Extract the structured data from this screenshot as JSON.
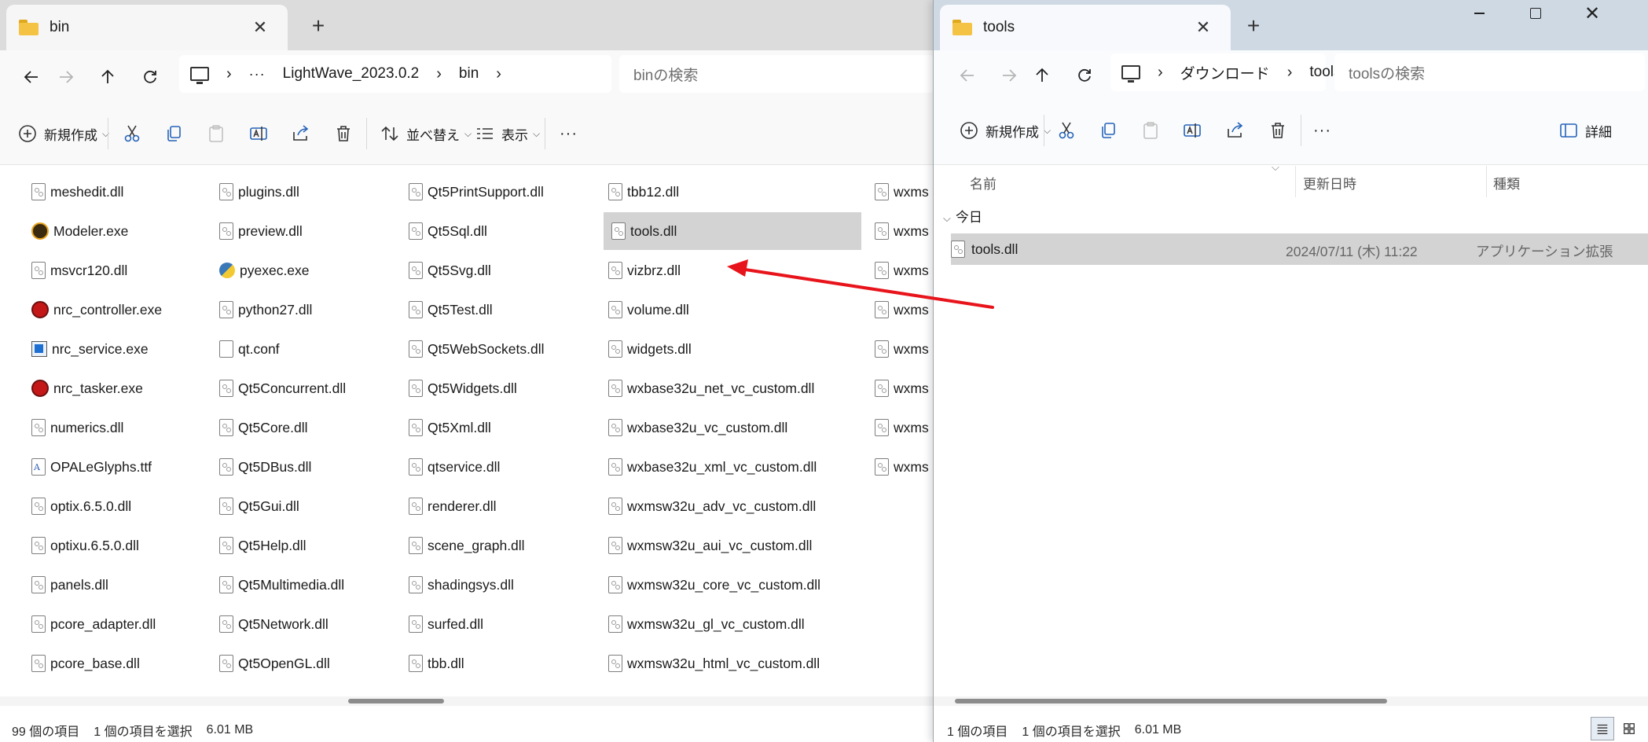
{
  "left_window": {
    "tab_title": "bin",
    "address": {
      "ellipsis": "···",
      "segments": [
        "LightWave_2023.0.2",
        "bin"
      ]
    },
    "search_placeholder": "binの検索",
    "commands": {
      "new": "新規作成",
      "sort": "並べ替え",
      "view": "表示",
      "more": "···"
    },
    "columns": [
      [
        {
          "name": "meshedit.dll",
          "icon": "dll"
        },
        {
          "name": "Modeler.exe",
          "icon": "lw"
        },
        {
          "name": "msvcr120.dll",
          "icon": "dll"
        },
        {
          "name": "nrc_controller.exe",
          "icon": "nrc"
        },
        {
          "name": "nrc_service.exe",
          "icon": "svc"
        },
        {
          "name": "nrc_tasker.exe",
          "icon": "nrc"
        },
        {
          "name": "numerics.dll",
          "icon": "dll"
        },
        {
          "name": "OPALeGlyphs.ttf",
          "icon": "ttf"
        },
        {
          "name": "optix.6.5.0.dll",
          "icon": "dll"
        },
        {
          "name": "optixu.6.5.0.dll",
          "icon": "dll"
        },
        {
          "name": "panels.dll",
          "icon": "dll"
        },
        {
          "name": "pcore_adapter.dll",
          "icon": "dll"
        },
        {
          "name": "pcore_base.dll",
          "icon": "dll"
        }
      ],
      [
        {
          "name": "plugins.dll",
          "icon": "dll"
        },
        {
          "name": "preview.dll",
          "icon": "dll"
        },
        {
          "name": "pyexec.exe",
          "icon": "py"
        },
        {
          "name": "python27.dll",
          "icon": "dll"
        },
        {
          "name": "qt.conf",
          "icon": "conf"
        },
        {
          "name": "Qt5Concurrent.dll",
          "icon": "dll"
        },
        {
          "name": "Qt5Core.dll",
          "icon": "dll"
        },
        {
          "name": "Qt5DBus.dll",
          "icon": "dll"
        },
        {
          "name": "Qt5Gui.dll",
          "icon": "dll"
        },
        {
          "name": "Qt5Help.dll",
          "icon": "dll"
        },
        {
          "name": "Qt5Multimedia.dll",
          "icon": "dll"
        },
        {
          "name": "Qt5Network.dll",
          "icon": "dll"
        },
        {
          "name": "Qt5OpenGL.dll",
          "icon": "dll"
        }
      ],
      [
        {
          "name": "Qt5PrintSupport.dll",
          "icon": "dll"
        },
        {
          "name": "Qt5Sql.dll",
          "icon": "dll"
        },
        {
          "name": "Qt5Svg.dll",
          "icon": "dll"
        },
        {
          "name": "Qt5Test.dll",
          "icon": "dll"
        },
        {
          "name": "Qt5WebSockets.dll",
          "icon": "dll"
        },
        {
          "name": "Qt5Widgets.dll",
          "icon": "dll"
        },
        {
          "name": "Qt5Xml.dll",
          "icon": "dll"
        },
        {
          "name": "qtservice.dll",
          "icon": "dll"
        },
        {
          "name": "renderer.dll",
          "icon": "dll"
        },
        {
          "name": "scene_graph.dll",
          "icon": "dll"
        },
        {
          "name": "shadingsys.dll",
          "icon": "dll"
        },
        {
          "name": "surfed.dll",
          "icon": "dll"
        },
        {
          "name": "tbb.dll",
          "icon": "dll"
        }
      ],
      [
        {
          "name": "tbb12.dll",
          "icon": "dll"
        },
        {
          "name": "tools.dll",
          "icon": "dll",
          "selected": true
        },
        {
          "name": "vizbrz.dll",
          "icon": "dll"
        },
        {
          "name": "volume.dll",
          "icon": "dll"
        },
        {
          "name": "widgets.dll",
          "icon": "dll"
        },
        {
          "name": "wxbase32u_net_vc_custom.dll",
          "icon": "dll"
        },
        {
          "name": "wxbase32u_vc_custom.dll",
          "icon": "dll"
        },
        {
          "name": "wxbase32u_xml_vc_custom.dll",
          "icon": "dll"
        },
        {
          "name": "wxmsw32u_adv_vc_custom.dll",
          "icon": "dll"
        },
        {
          "name": "wxmsw32u_aui_vc_custom.dll",
          "icon": "dll"
        },
        {
          "name": "wxmsw32u_core_vc_custom.dll",
          "icon": "dll"
        },
        {
          "name": "wxmsw32u_gl_vc_custom.dll",
          "icon": "dll"
        },
        {
          "name": "wxmsw32u_html_vc_custom.dll",
          "icon": "dll"
        }
      ],
      [
        {
          "name": "wxms",
          "icon": "dll"
        },
        {
          "name": "wxms",
          "icon": "dll"
        },
        {
          "name": "wxms",
          "icon": "dll"
        },
        {
          "name": "wxms",
          "icon": "dll"
        },
        {
          "name": "wxms",
          "icon": "dll"
        },
        {
          "name": "wxms",
          "icon": "dll"
        },
        {
          "name": "wxms",
          "icon": "dll"
        },
        {
          "name": "wxms",
          "icon": "dll"
        }
      ]
    ],
    "status": {
      "count": "99 個の項目",
      "selection": "1 個の項目を選択",
      "size": "6.01 MB"
    }
  },
  "right_window": {
    "tab_title": "tools",
    "address": {
      "segments": [
        "ダウンロード",
        "tools"
      ]
    },
    "search_placeholder": "toolsの検索",
    "commands": {
      "new": "新規作成",
      "more": "···",
      "details": "詳細"
    },
    "headers": {
      "name": "名前",
      "modified": "更新日時",
      "type": "種類"
    },
    "group": "今日",
    "file": {
      "name": "tools.dll",
      "modified": "2024/07/11 (木) 11:22",
      "type": "アプリケーション拡張"
    },
    "status": {
      "count": "1 個の項目",
      "selection": "1 個の項目を選択",
      "size": "6.01 MB"
    }
  },
  "colors": {
    "arrow": "#e8141b",
    "selection": "#d3d3d3",
    "folder": "#f5c344"
  }
}
